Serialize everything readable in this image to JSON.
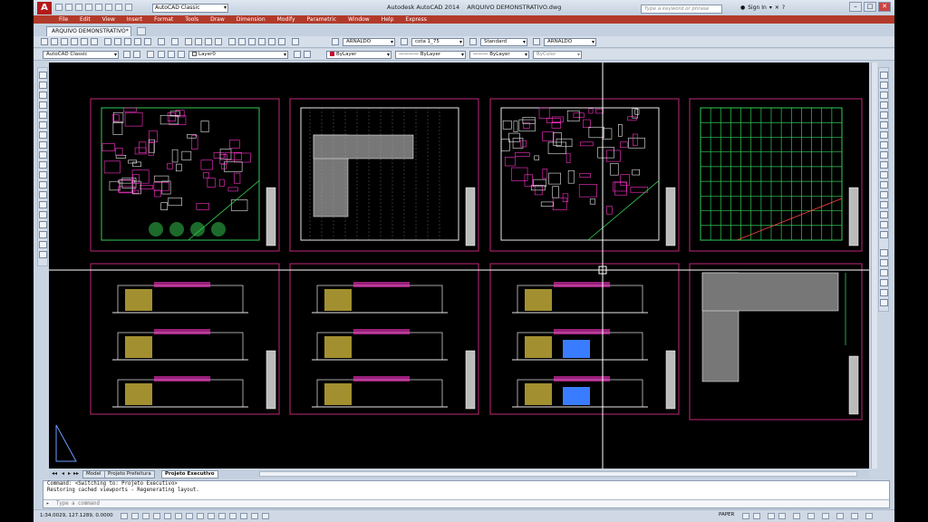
{
  "app": {
    "logo_letter": "A",
    "title": "Autodesk AutoCAD 2014",
    "file_title": "ARQUIVO DEMONSTRATIVO.dwg",
    "workspace": "AutoCAD Classic",
    "search_placeholder": "Type a keyword or phrase",
    "sign_in": "Sign In"
  },
  "menu": [
    "File",
    "Edit",
    "View",
    "Insert",
    "Format",
    "Tools",
    "Draw",
    "Dimension",
    "Modify",
    "Parametric",
    "Window",
    "Help",
    "Express"
  ],
  "doc_tab": {
    "label": "ARQUIVO DEMONSTRATIVO*"
  },
  "styles_toolbar": {
    "text_style": "ARNALDO",
    "dim_style": "cota 1_75",
    "table_style": "Standard",
    "mleader_style": "ARNALDO"
  },
  "layers_toolbar": {
    "workspace": "AutoCAD Classic",
    "layer": "Layer0",
    "color": "ByLayer",
    "linetype": "ByLayer",
    "lineweight": "ByLayer",
    "plotstyle": "ByColor"
  },
  "layout_tabs": [
    {
      "label": "Model",
      "active": false
    },
    {
      "label": "Projeto Prefeitura",
      "active": false
    },
    {
      "label": "Projeto Executivo",
      "active": true
    }
  ],
  "command_history": [
    "Command:  <Switching to: Projeto Executivo>",
    "Restoring cached viewports - Regenerating layout."
  ],
  "command_prompt": "Type a command",
  "status": {
    "coords": "1:34.0029, 127.1289, 0.0000",
    "space": "PAPER"
  },
  "colors": {
    "accent_menu": "#b23a2a",
    "canvas_bg": "#000000",
    "sheet_border": "#c0287a",
    "drawing_white": "#e8e8e8",
    "drawing_green": "#33cc55",
    "drawing_magenta": "#ff33cc",
    "drawing_yellow": "#d8c040",
    "drawing_blue": "#3a7cff"
  }
}
